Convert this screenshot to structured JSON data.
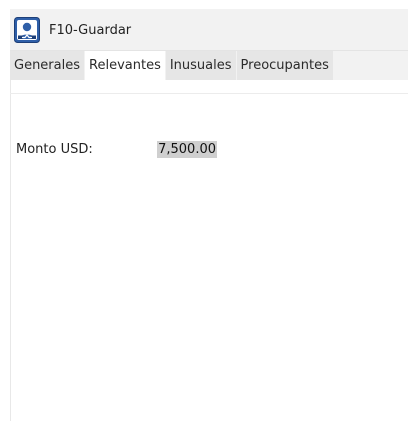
{
  "toolbar": {
    "save_label": "F10-Guardar",
    "save_icon": "save-user-icon"
  },
  "tabs": [
    {
      "label": "Generales",
      "active": false
    },
    {
      "label": "Relevantes",
      "active": true
    },
    {
      "label": "Inusuales",
      "active": false
    },
    {
      "label": "Preocupantes",
      "active": false
    }
  ],
  "form": {
    "monto_label": "Monto USD:",
    "monto_value": "7,500.00"
  },
  "colors": {
    "toolbar_bg": "#f2f2f2",
    "tab_inactive_bg": "#e6e6e6",
    "tab_active_bg": "#ffffff",
    "selection_bg": "#cfcfcf",
    "icon_blue": "#2f5fa8"
  }
}
